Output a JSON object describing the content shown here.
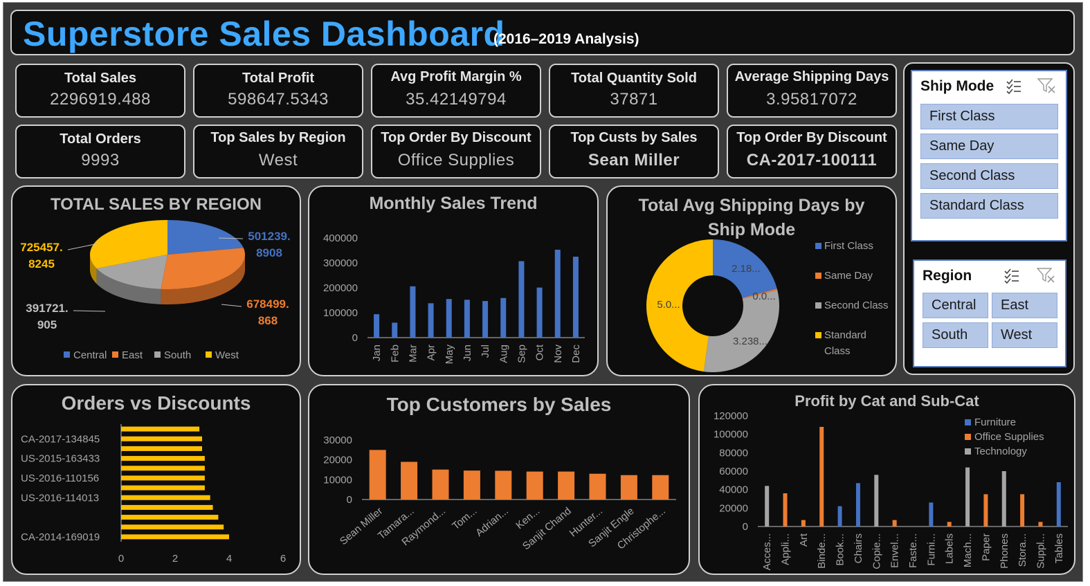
{
  "header": {
    "title": "Superstore Sales Dashboard",
    "subtitle": "(2016–2019 Analysis)"
  },
  "kpis": [
    {
      "label": "Total Sales",
      "value": "2296919.488"
    },
    {
      "label": "Total Profit",
      "value": "598647.5343"
    },
    {
      "label": "Avg Profit Margin %",
      "value": "35.42149794"
    },
    {
      "label": "Total Quantity Sold",
      "value": "37871"
    },
    {
      "label": "Average Shipping Days",
      "value": "3.95817072"
    },
    {
      "label": "Total Orders",
      "value": "9993"
    },
    {
      "label": "Top Sales by Region",
      "value": "West"
    },
    {
      "label": "Top Order By Discount",
      "value": "Office Supplies"
    },
    {
      "label": "Top Custs by Sales",
      "value": "Sean Miller"
    },
    {
      "label": "Top Order By Discount",
      "value": "CA-2017-100111"
    }
  ],
  "slicers": {
    "ship_mode": {
      "title": "Ship Mode",
      "items": [
        "First Class",
        "Same Day",
        "Second Class",
        "Standard Class"
      ]
    },
    "region": {
      "title": "Region",
      "items": [
        "Central",
        "East",
        "South",
        "West"
      ]
    }
  },
  "colors": {
    "blue": "#4472c4",
    "orange": "#ed7d31",
    "gray": "#a5a5a5",
    "yellow": "#ffc000",
    "title_blue": "#3ea8ff"
  },
  "chart_data": [
    {
      "type": "pie",
      "title": "TOTAL SALES BY REGION",
      "categories": [
        "Central",
        "East",
        "South",
        "West"
      ],
      "values": [
        501239.8908,
        678499.868,
        391721.905,
        725457.8245
      ],
      "labels": [
        "501239.\n8908",
        "678499.\n868",
        "391721.\n905",
        "725457.\n8245"
      ],
      "colors": [
        "#4472c4",
        "#ed7d31",
        "#a5a5a5",
        "#ffc000"
      ],
      "legend": "bottom"
    },
    {
      "type": "bar",
      "title": "Monthly Sales Trend",
      "categories": [
        "Jan",
        "Feb",
        "Mar",
        "Apr",
        "May",
        "Jun",
        "Jul",
        "Aug",
        "Sep",
        "Oct",
        "Nov",
        "Dec"
      ],
      "values": [
        94000,
        60000,
        206000,
        138000,
        155000,
        152000,
        147000,
        159000,
        307000,
        201000,
        353000,
        325000
      ],
      "yticks": [
        "0",
        "100000",
        "200000",
        "300000",
        "400000"
      ],
      "ylim": [
        0,
        400000
      ],
      "color": "#4472c4"
    },
    {
      "type": "pie",
      "subtype": "donut",
      "title": "Total Avg Shipping Days by Ship Mode",
      "categories": [
        "First Class",
        "Same Day",
        "Second Class",
        "Standard Class"
      ],
      "values": [
        2.18,
        0.04,
        3.238,
        5.0
      ],
      "labels": [
        "2.18...",
        "0.0...",
        "3.238...",
        "5.0..."
      ],
      "colors": [
        "#4472c4",
        "#ed7d31",
        "#a5a5a5",
        "#ffc000"
      ],
      "legend": "right"
    },
    {
      "type": "bar",
      "orientation": "horizontal",
      "title": "Orders vs Discounts",
      "categories": [
        "CA-2014-169019",
        "",
        "",
        "",
        "US-2016-114013",
        "",
        "US-2016-110156",
        "",
        "US-2015-163433",
        "",
        "CA-2017-134845",
        ""
      ],
      "values": [
        4.0,
        3.8,
        3.6,
        3.4,
        3.3,
        3.1,
        3.1,
        3.1,
        3.1,
        3.0,
        3.0,
        2.9
      ],
      "xticks": [
        "0",
        "2",
        "4",
        "6"
      ],
      "xlim": [
        0,
        6
      ],
      "color": "#ffc000"
    },
    {
      "type": "bar",
      "title": "Top Customers by Sales",
      "categories": [
        "Sean Miller",
        "Tamara...",
        "Raymond...",
        "Tom...",
        "Adrian...",
        "Ken...",
        "Sanjit Chand",
        "Hunter...",
        "Sanjit Engle",
        "Christophe..."
      ],
      "values": [
        25000,
        19000,
        15100,
        14600,
        14500,
        14100,
        14100,
        13000,
        12300,
        12300
      ],
      "yticks": [
        "0",
        "10000",
        "20000",
        "30000"
      ],
      "ylim": [
        0,
        30000
      ],
      "color": "#ed7d31"
    },
    {
      "type": "bar",
      "title": "Profit by Cat and Sub-Cat",
      "categories": [
        "Acces...",
        "Appli...",
        "Art",
        "Binde...",
        "Book...",
        "Chairs",
        "Copie...",
        "Envel...",
        "Faste...",
        "Furni...",
        "Labels",
        "Mach...",
        "Paper",
        "Phones",
        "Stora...",
        "Suppl...",
        "Tables"
      ],
      "series": [
        {
          "name": "Furniture",
          "values": [
            null,
            null,
            null,
            null,
            22000,
            47000,
            null,
            null,
            null,
            26000,
            null,
            null,
            null,
            null,
            null,
            null,
            48000
          ]
        },
        {
          "name": "Office Supplies",
          "values": [
            null,
            36000,
            7000,
            108000,
            null,
            null,
            null,
            7000,
            null,
            null,
            5000,
            null,
            35000,
            null,
            35000,
            5000,
            null
          ]
        },
        {
          "name": "Technology",
          "values": [
            44000,
            null,
            null,
            null,
            null,
            null,
            56000,
            null,
            null,
            null,
            null,
            64000,
            null,
            60000,
            null,
            null,
            null
          ]
        }
      ],
      "yticks": [
        "0",
        "20000",
        "40000",
        "60000",
        "80000",
        "100000",
        "120000"
      ],
      "ylim": [
        0,
        120000
      ],
      "colors": [
        "#4472c4",
        "#ed7d31",
        "#a5a5a5"
      ],
      "legend": "top-right"
    }
  ]
}
